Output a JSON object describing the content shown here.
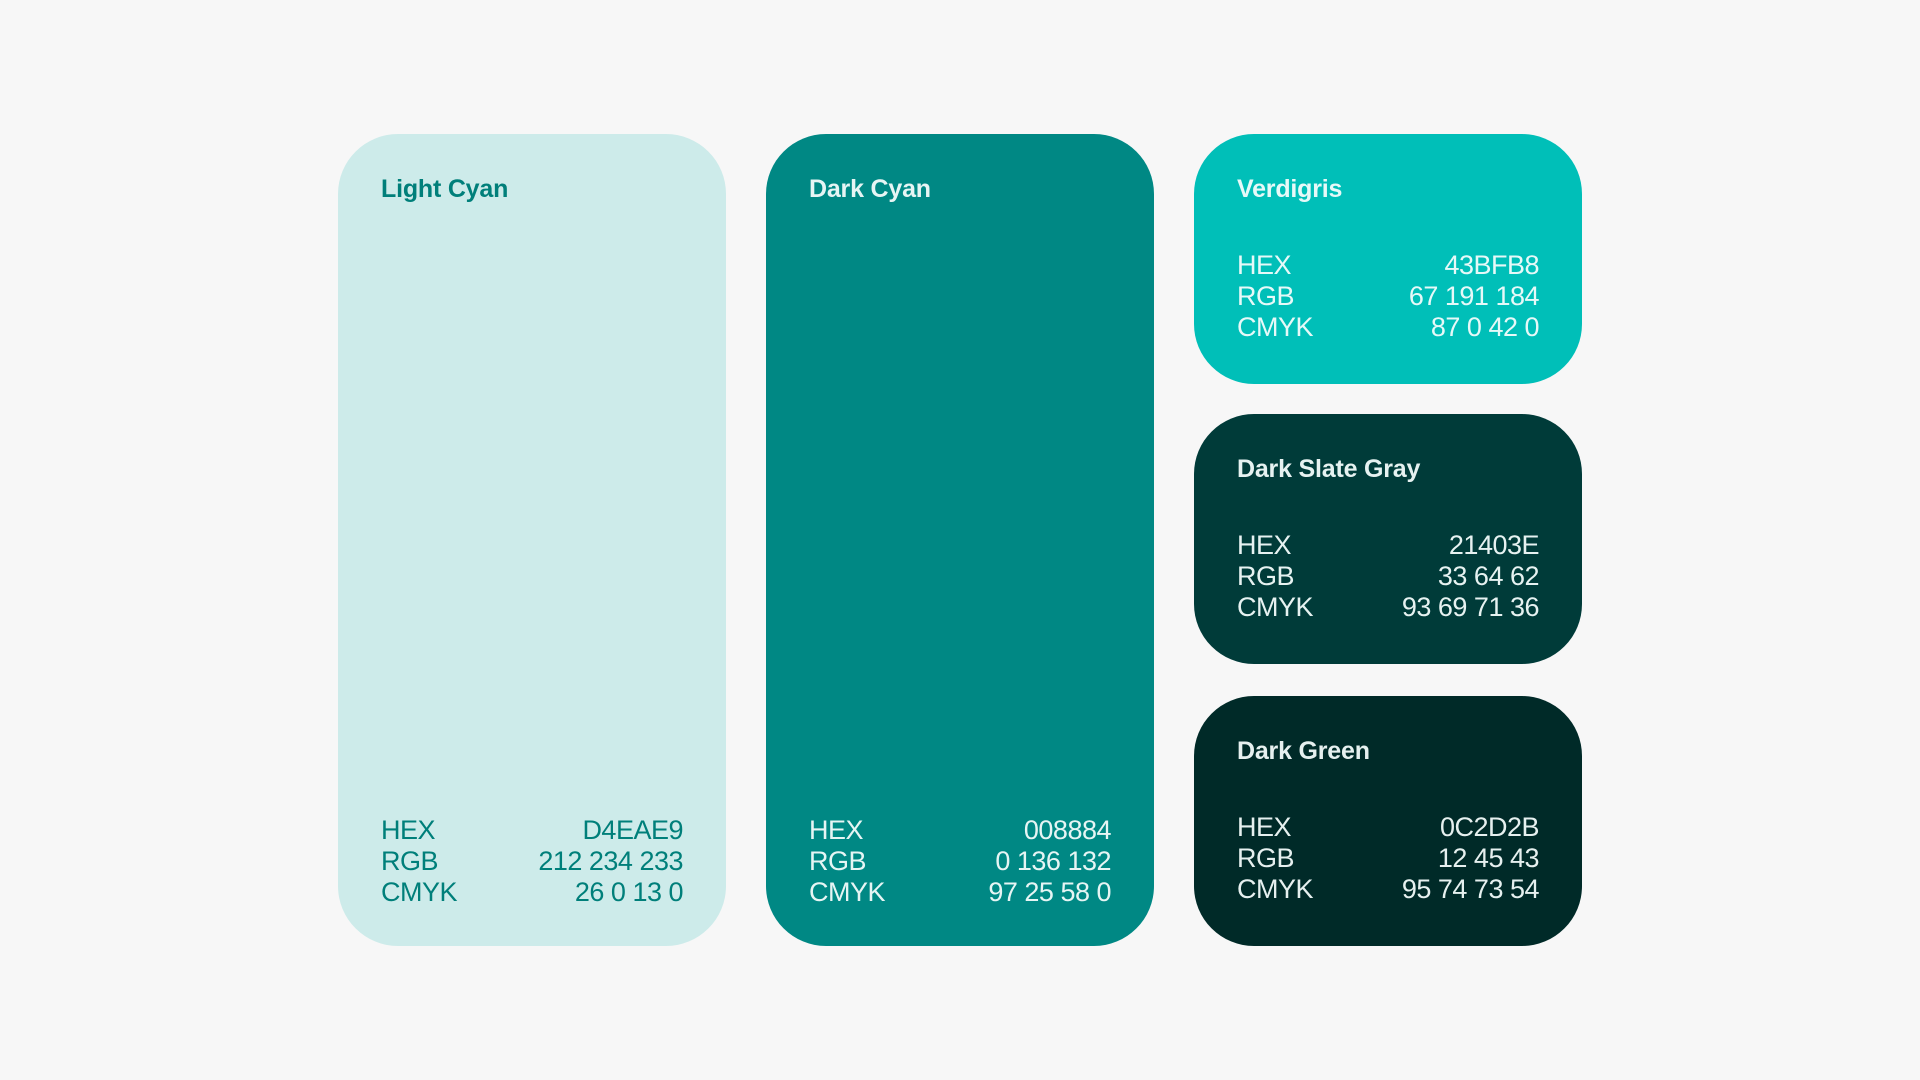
{
  "swatches": [
    {
      "name": "Light Cyan",
      "background": "#CDEBEA",
      "text_color": "#007F7A",
      "hex_label": "HEX",
      "hex": "D4EAE9",
      "rgb_label": "RGB",
      "rgb": "212 234 233",
      "cmyk_label": "CMYK",
      "cmyk": "26 0 13 0"
    },
    {
      "name": "Dark Cyan",
      "background": "#008884",
      "text_color": "#E6F5F4",
      "hex_label": "HEX",
      "hex": "008884",
      "rgb_label": "RGB",
      "rgb": "0 136 132",
      "cmyk_label": "CMYK",
      "cmyk": "97 25 58 0"
    },
    {
      "name": "Verdigris",
      "background": "#00BFB8",
      "text_color": "#E6F9F8",
      "hex_label": "HEX",
      "hex": "43BFB8",
      "rgb_label": "RGB",
      "rgb": "67 191 184",
      "cmyk_label": "CMYK",
      "cmyk": "87 0 42 0"
    },
    {
      "name": "Dark Slate Gray",
      "background": "#003B39",
      "text_color": "#E6F2F1",
      "hex_label": "HEX",
      "hex": "21403E",
      "rgb_label": "RGB",
      "rgb": "33 64 62",
      "cmyk_label": "CMYK",
      "cmyk": "93 69 71 36"
    },
    {
      "name": "Dark Green",
      "background": "#002A28",
      "text_color": "#E6F0EF",
      "hex_label": "HEX",
      "hex": "0C2D2B",
      "rgb_label": "RGB",
      "rgb": "12 45 43",
      "cmyk_label": "CMYK",
      "cmyk": "95 74 73 54"
    }
  ]
}
